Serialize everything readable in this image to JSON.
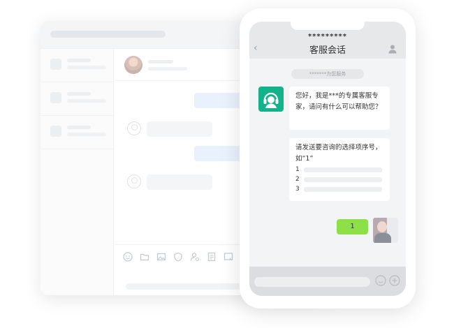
{
  "phone": {
    "contact_name": "*********",
    "chat_title": "客服会话",
    "system_tip": "*******为您服务",
    "messages": {
      "greeting": "您好，我是***的专属客服专家，请问有什么可以帮助您？",
      "prompt": "请发送要咨询的选择项序号，如“1”",
      "options": [
        "1",
        "2",
        "3"
      ],
      "user_reply": "1"
    }
  },
  "colors": {
    "bot_avatar": "#12b28a",
    "user_bubble": "#8ee048",
    "desk_bubble": "#e9f1fd"
  },
  "icons": {
    "back": "chevron-left-icon",
    "profile": "user-icon",
    "emoji": "smile-icon",
    "plus": "plus-circle-icon",
    "desk_tools": [
      "smile-icon",
      "folder-icon",
      "image-icon",
      "shield-icon",
      "user-settings-icon",
      "note-icon",
      "screenshot-icon"
    ]
  }
}
